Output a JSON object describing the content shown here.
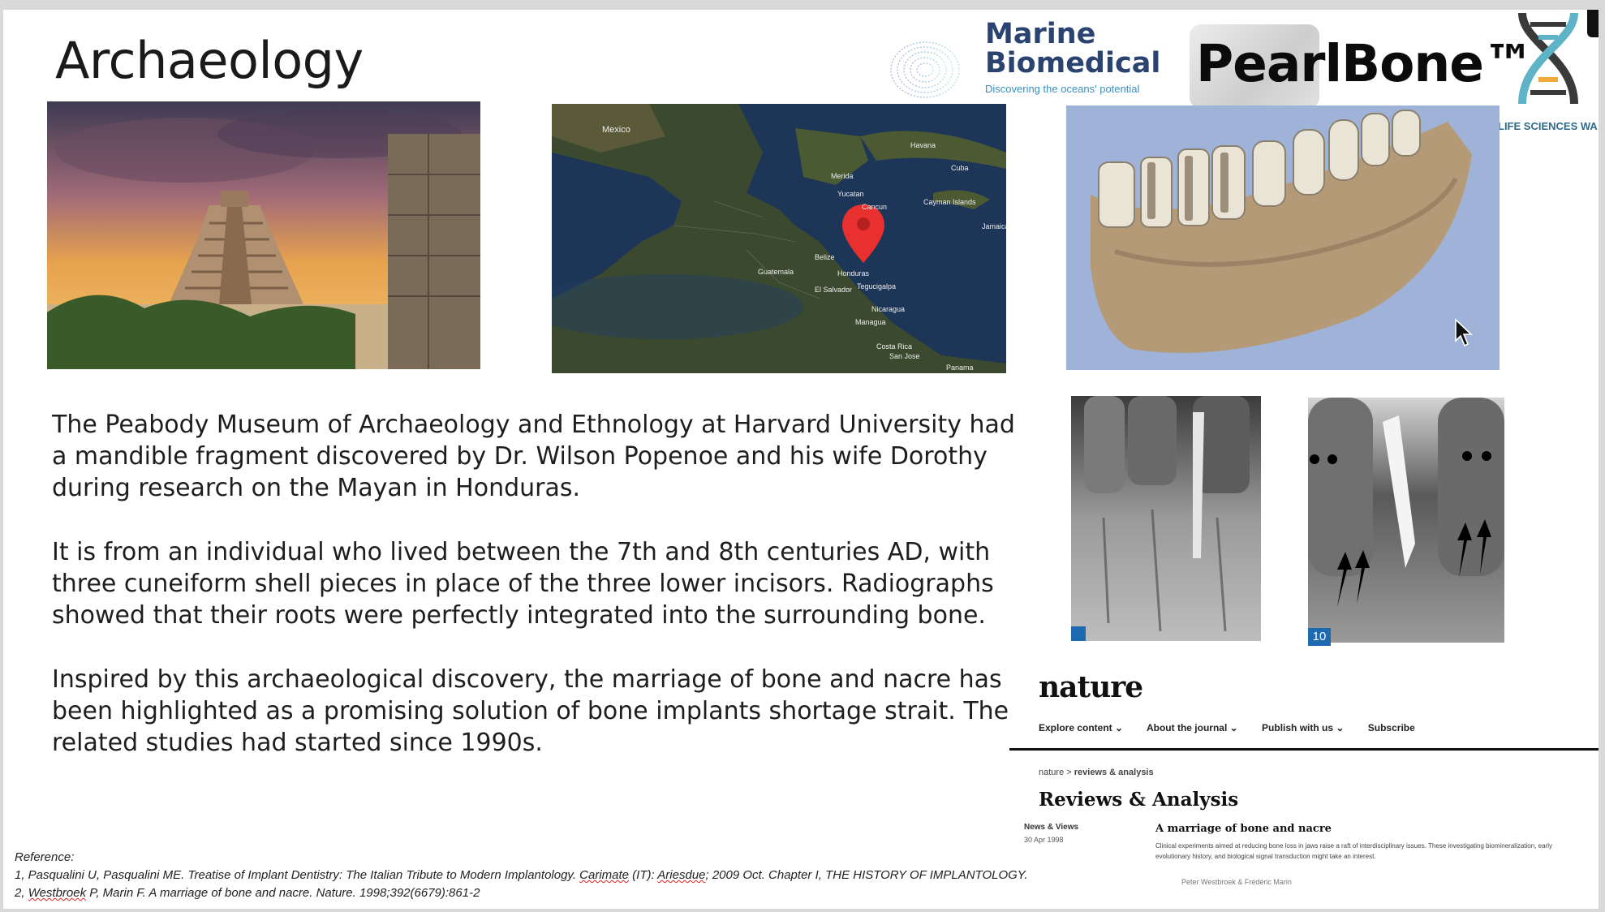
{
  "slide": {
    "title": "Archaeology",
    "logos": {
      "marine_line1": "Marine",
      "marine_line2": "Biomedical",
      "marine_tagline": "Discovering the oceans' potential",
      "pearlbone": "PearlBone™",
      "lifesciences": "LIFE SCIENCES WA"
    },
    "paragraphs": [
      "The Peabody Museum of Archaeology and Ethnology at Harvard University had a mandible fragment discovered by Dr. Wilson Popenoe and his wife Dorothy during research on the Mayan in Honduras.",
      "It is from an individual who lived between the 7th and 8th centuries AD, with three cuneiform shell pieces in place of the three lower incisors. Radiographs showed that their roots were perfectly integrated into the surrounding bone.",
      "Inspired by this archaeological discovery, the marriage of bone and nacre has been highlighted as a promising solution of bone implants shortage strait. The related studies had started since 1990s."
    ],
    "map_labels": [
      "Mexico",
      "Belize",
      "Honduras",
      "Guatemala",
      "Nicaragua",
      "Costa Rica",
      "Panama",
      "Cuba",
      "Havana",
      "Cayman Islands",
      "Jamaica",
      "Tegucigalpa",
      "Managua",
      "San Jose",
      "El Salvador",
      "Yucatan",
      "Merida",
      "Cancun"
    ],
    "xray_number": "10",
    "nature": {
      "logo": "nature",
      "nav": [
        "Explore content ⌄",
        "About the journal ⌄",
        "Publish with us ⌄",
        "Subscribe"
      ],
      "breadcrumb_1": "nature",
      "breadcrumb_sep": ">",
      "breadcrumb_2": "reviews & analysis",
      "heading": "Reviews & Analysis",
      "kind": "News & Views",
      "date": "30 Apr 1998",
      "article_title": "A marriage of bone and nacre",
      "abstract": "Clinical experiments aimed at reducing bone loss in jaws raise a raft of interdisciplinary issues. These investigating biomineralization, early evolutionary history, and biological signal transduction might take an interest.",
      "authors": "Peter Westbroek & Frédéric Marin"
    },
    "references": {
      "label": "Reference:",
      "ref1_start": "1, Pasqualini U, Pasqualini ME. Treatise of Implant Dentistry: The Italian Tribute to Modern Implantology. ",
      "ref1_w1": "Carimate",
      "ref1_mid": " (IT): ",
      "ref1_w2": "Ariesdue",
      "ref1_end": "; 2009 Oct. Chapter I, THE HISTORY OF IMPLANTOLOGY.",
      "ref2_start": "2, ",
      "ref2_w1": "Westbroek",
      "ref2_end": " P, Marin F. A marriage of bone and nacre. Nature. 1998;392(6679):861-2"
    }
  }
}
